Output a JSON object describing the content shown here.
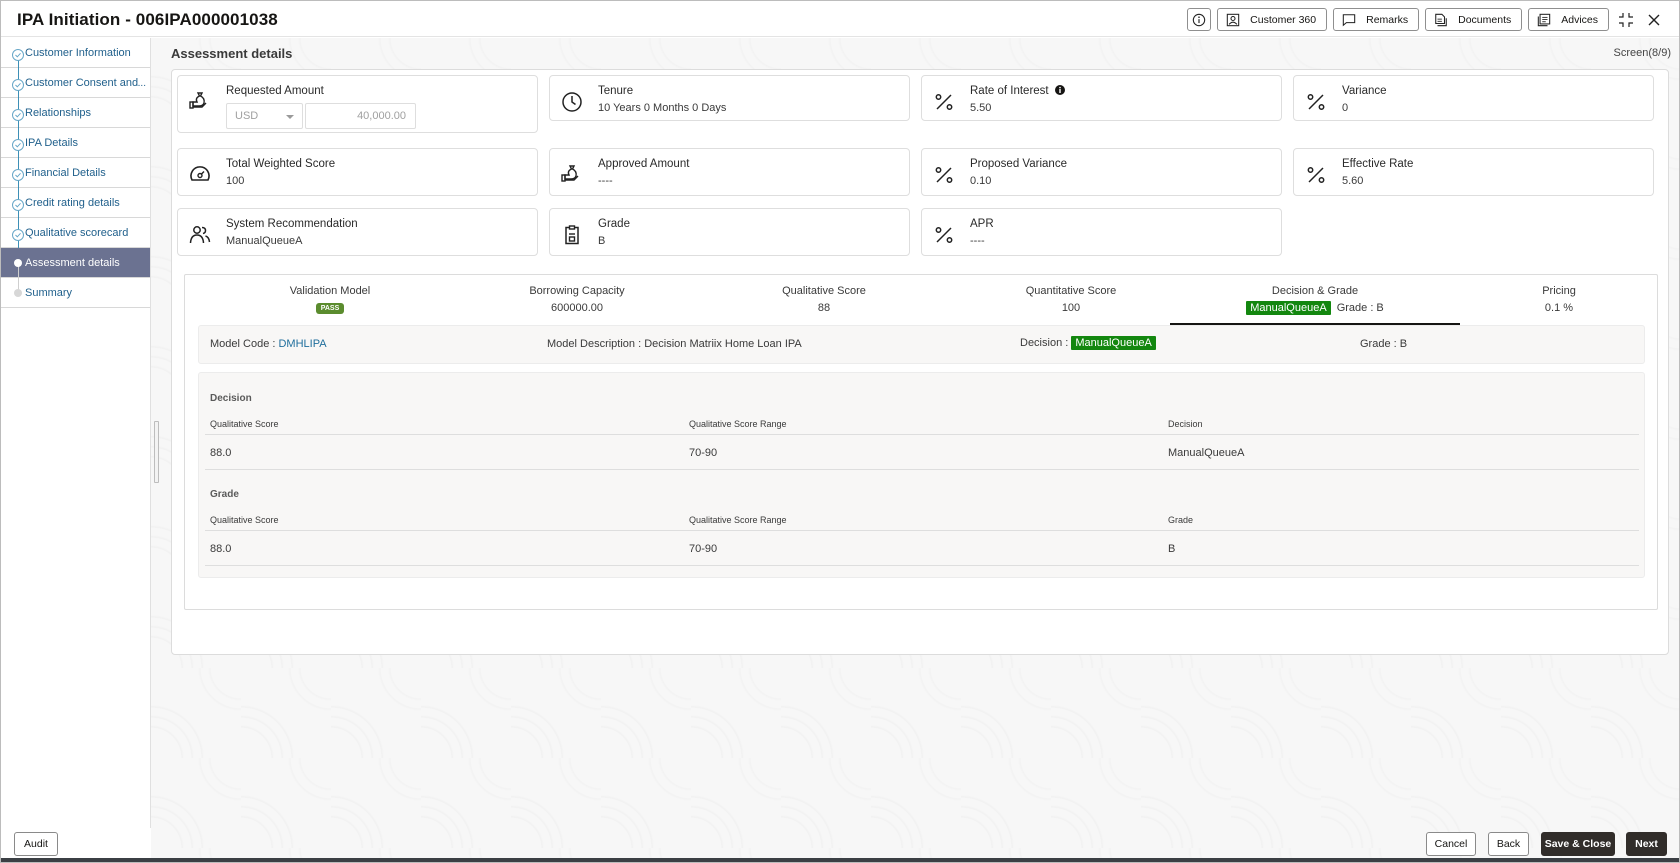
{
  "header": {
    "title": "IPA Initiation - 006IPA000001038",
    "buttons": {
      "info": "",
      "customer360": "Customer 360",
      "remarks": "Remarks",
      "documents": "Documents",
      "advices": "Advices"
    }
  },
  "sidebar": {
    "steps": [
      {
        "label": "Customer Information",
        "state": "done"
      },
      {
        "label": "Customer Consent and",
        "state": "done",
        "overflow": "..."
      },
      {
        "label": "Relationships",
        "state": "done"
      },
      {
        "label": "IPA Details",
        "state": "done"
      },
      {
        "label": "Financial Details",
        "state": "done"
      },
      {
        "label": "Credit rating details",
        "state": "done"
      },
      {
        "label": "Qualitative scorecard",
        "state": "done"
      },
      {
        "label": "Assessment details",
        "state": "active"
      },
      {
        "label": "Summary",
        "state": "pending"
      }
    ]
  },
  "main": {
    "section_title": "Assessment details",
    "screen_count": "Screen(8/9)",
    "cards": {
      "requested_amount": {
        "label": "Requested Amount",
        "currency": "USD",
        "amount": "40,000.00"
      },
      "tenure": {
        "label": "Tenure",
        "value": "10 Years 0 Months 0 Days"
      },
      "rate_of_interest": {
        "label": "Rate of Interest",
        "value": "5.50"
      },
      "variance": {
        "label": "Variance",
        "value": "0"
      },
      "total_weighted_score": {
        "label": "Total Weighted Score",
        "value": "100"
      },
      "approved_amount": {
        "label": "Approved Amount",
        "value": "----"
      },
      "proposed_variance": {
        "label": "Proposed Variance",
        "value": "0.10"
      },
      "effective_rate": {
        "label": "Effective Rate",
        "value": "5.60"
      },
      "system_recommendation": {
        "label": "System Recommendation",
        "value": "ManualQueueA"
      },
      "grade": {
        "label": "Grade",
        "value": "B"
      },
      "apr": {
        "label": "APR",
        "value": "----"
      }
    },
    "model_tabs": [
      {
        "title": "Validation Model",
        "value": "PASS"
      },
      {
        "title": "Borrowing Capacity",
        "value": "600000.00"
      },
      {
        "title": "Qualitative Score",
        "value": "88"
      },
      {
        "title": "Quantitative Score",
        "value": "100"
      },
      {
        "title": "Decision & Grade",
        "decision": "ManualQueueA",
        "grade": "Grade : B"
      },
      {
        "title": "Pricing",
        "value": "0.1 %"
      }
    ],
    "model_info": {
      "code_label": "Model Code : ",
      "code_value": "DMHLIPA",
      "description": "Model Description : Decision Matriix Home Loan IPA",
      "decision_label": "Decision : ",
      "decision_value": "ManualQueueA",
      "grade": "Grade : B"
    },
    "decision_table": {
      "title": "Decision",
      "columns": [
        "Qualitative Score",
        "Qualitative Score Range",
        "Decision"
      ],
      "rows": [
        [
          "88.0",
          "70-90",
          "ManualQueueA"
        ]
      ]
    },
    "grade_table": {
      "title": "Grade",
      "columns": [
        "Qualitative Score",
        "Qualitative Score Range",
        "Grade"
      ],
      "rows": [
        [
          "88.0",
          "70-90",
          "B"
        ]
      ]
    }
  },
  "footer": {
    "audit": "Audit",
    "cancel": "Cancel",
    "back": "Back",
    "save_close": "Save & Close",
    "next": "Next"
  },
  "colors": {
    "accent_link": "#1f6e9c",
    "active_step": "#6b7291",
    "pass_badge": "#5b8c2e",
    "decision_badge": "#13870f",
    "primary_button": "#312d2a"
  }
}
